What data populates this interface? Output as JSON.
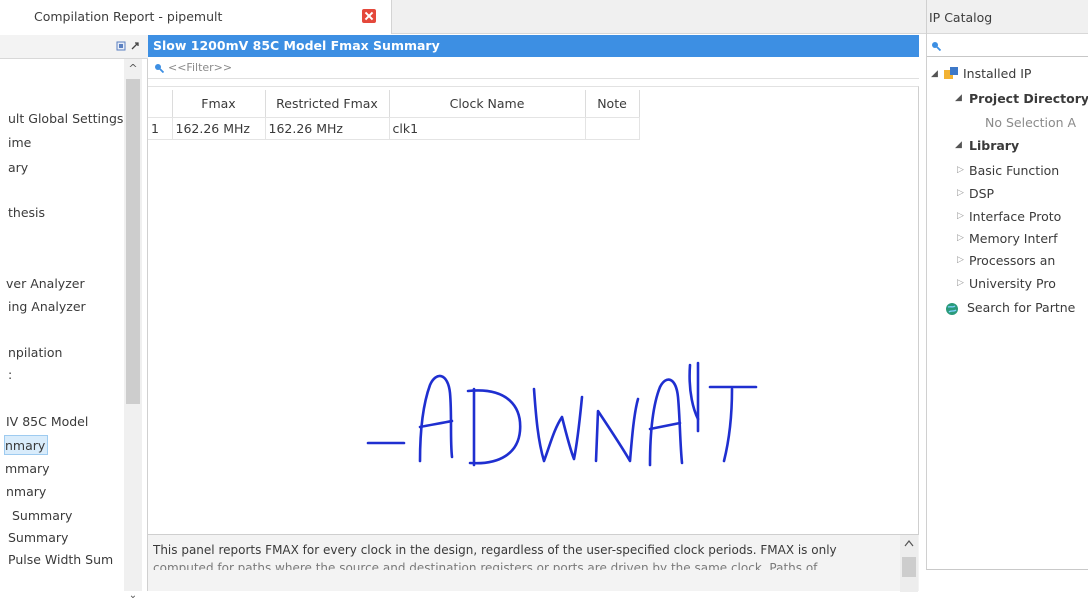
{
  "tab": {
    "title": "Compilation Report - pipemult"
  },
  "left_nav": {
    "items": [
      {
        "label": "ult Global Settings",
        "selected": false
      },
      {
        "label": "ime",
        "selected": false
      },
      {
        "label": "ary",
        "selected": false
      },
      {
        "label": "thesis",
        "selected": false
      },
      {
        "label": "ver Analyzer",
        "selected": false
      },
      {
        "label": "ing Analyzer",
        "selected": false
      },
      {
        "label": "npilation",
        "selected": false
      },
      {
        "label": ":",
        "selected": false
      },
      {
        "label": "IV 85C Model",
        "selected": false
      },
      {
        "label": "nmary",
        "selected": true
      },
      {
        "label": "mmary",
        "selected": false
      },
      {
        "label": "nmary",
        "selected": false
      },
      {
        "label": "Summary",
        "selected": false
      },
      {
        "label": "Summary",
        "selected": false
      },
      {
        "label": "Pulse Width Sum",
        "selected": false
      }
    ]
  },
  "main": {
    "title": "Slow 1200mV 85C Model Fmax Summary",
    "filter_placeholder": "<<Filter>>",
    "table": {
      "headers": [
        "",
        "Fmax",
        "Restricted Fmax",
        "Clock Name",
        "Note"
      ],
      "rows": [
        [
          "1",
          "162.26 MHz",
          "162.26 MHz",
          "clk1",
          ""
        ]
      ]
    },
    "description": "This panel reports FMAX for every clock in the design, regardless of the user-specified clock periods.  FMAX is only",
    "description_cont": "computed for paths where the source and destination registers or ports are driven by the same clock.  Paths of"
  },
  "ip_catalog": {
    "title": "IP Catalog",
    "tree": {
      "installed": "Installed IP",
      "project_dir": "Project Directory",
      "no_selection": "No Selection A",
      "library": "Library",
      "library_children": [
        "Basic Function",
        "DSP",
        "Interface Proto",
        "Memory Interf",
        "Processors an",
        "University Pro"
      ],
      "search_partner": "Search for Partne"
    }
  },
  "colors": {
    "title_bar": "#3d8fe3",
    "signature_ink": "#1f2fd0",
    "close_button": "#e4483b"
  }
}
